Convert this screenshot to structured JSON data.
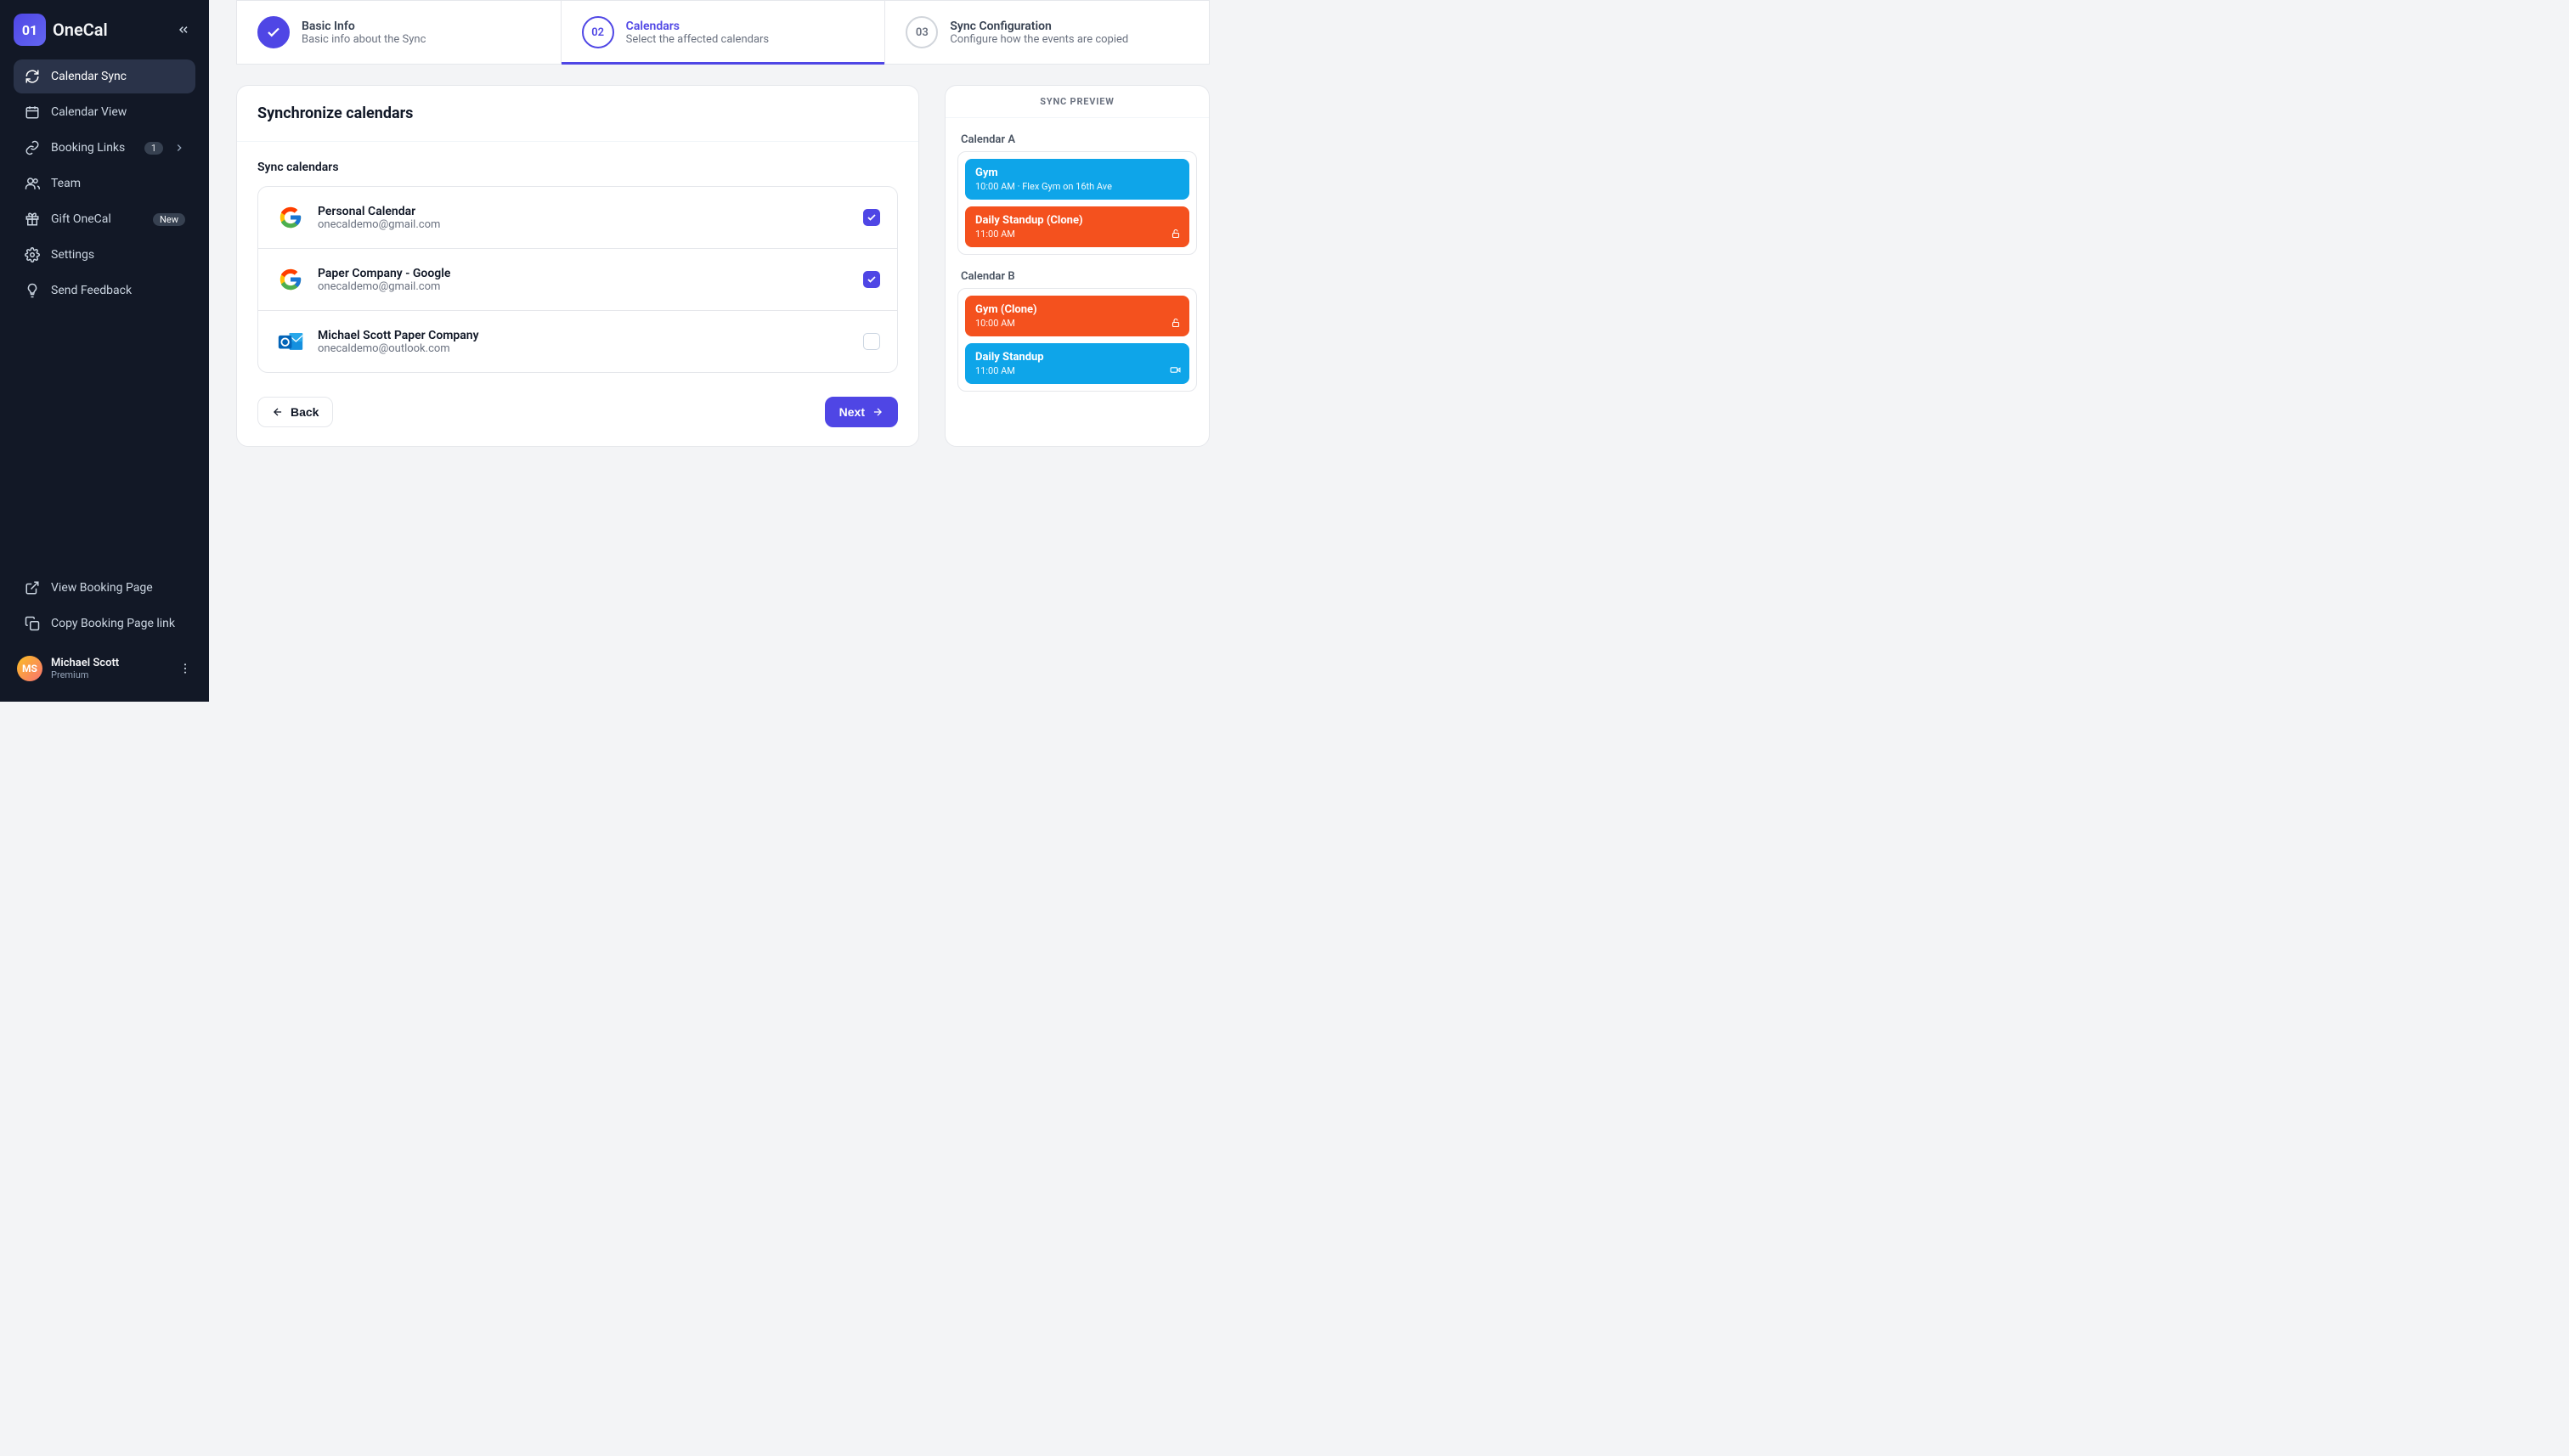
{
  "brand": {
    "logo_text": "01",
    "name": "OneCal"
  },
  "sidebar": {
    "items": [
      {
        "label": "Calendar Sync"
      },
      {
        "label": "Calendar View"
      },
      {
        "label": "Booking Links",
        "badge": "1"
      },
      {
        "label": "Team"
      },
      {
        "label": "Gift OneCal",
        "tag": "New"
      },
      {
        "label": "Settings"
      },
      {
        "label": "Send Feedback"
      }
    ],
    "footer": [
      {
        "label": "View Booking Page"
      },
      {
        "label": "Copy Booking Page link"
      }
    ],
    "user": {
      "name": "Michael Scott",
      "plan": "Premium",
      "initials": "MS"
    }
  },
  "stepper": [
    {
      "num": "",
      "title": "Basic Info",
      "sub": "Basic info about the Sync",
      "state": "done"
    },
    {
      "num": "02",
      "title": "Calendars",
      "sub": "Select the affected calendars",
      "state": "current"
    },
    {
      "num": "03",
      "title": "Sync Configuration",
      "sub": "Configure how the events are copied",
      "state": "upcoming"
    }
  ],
  "main_panel": {
    "heading": "Synchronize calendars",
    "section_label": "Sync calendars",
    "calendars": [
      {
        "name": "Personal Calendar",
        "email": "onecaldemo@gmail.com",
        "provider": "google",
        "checked": true
      },
      {
        "name": "Paper Company - Google",
        "email": "onecaldemo@gmail.com",
        "provider": "google",
        "checked": true
      },
      {
        "name": "Michael Scott Paper Company",
        "email": "onecaldemo@outlook.com",
        "provider": "outlook",
        "checked": false
      }
    ],
    "back_label": "Back",
    "next_label": "Next"
  },
  "preview": {
    "header": "SYNC PREVIEW",
    "groups": [
      {
        "label": "Calendar A",
        "events": [
          {
            "title": "Gym",
            "sub": "10:00 AM · Flex Gym on 16th Ave",
            "color": "blue",
            "icon": null
          },
          {
            "title": "Daily Standup (Clone)",
            "sub": "11:00 AM",
            "color": "orange",
            "icon": "lock"
          }
        ]
      },
      {
        "label": "Calendar B",
        "events": [
          {
            "title": "Gym (Clone)",
            "sub": "10:00 AM",
            "color": "orange",
            "icon": "lock"
          },
          {
            "title": "Daily Standup",
            "sub": "11:00 AM",
            "color": "blue",
            "icon": "video"
          }
        ]
      }
    ]
  }
}
